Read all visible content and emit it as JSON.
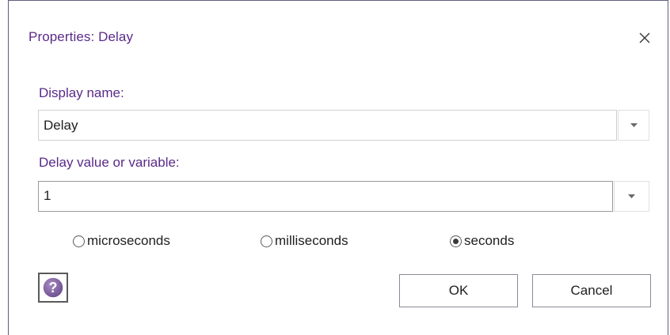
{
  "dialog": {
    "title": "Properties: Delay",
    "close_icon": "close-icon"
  },
  "display_name": {
    "label": "Display name:",
    "value": "Delay"
  },
  "delay_value": {
    "label": "Delay value or variable:",
    "value": "1"
  },
  "units": {
    "options": [
      {
        "label": "microseconds",
        "selected": false
      },
      {
        "label": "milliseconds",
        "selected": false
      },
      {
        "label": "seconds",
        "selected": true
      }
    ]
  },
  "buttons": {
    "ok": "OK",
    "cancel": "Cancel",
    "help_icon": "question-circle-icon"
  },
  "colors": {
    "accent": "#5a2a8a",
    "help_icon": "#7a5a9a"
  }
}
